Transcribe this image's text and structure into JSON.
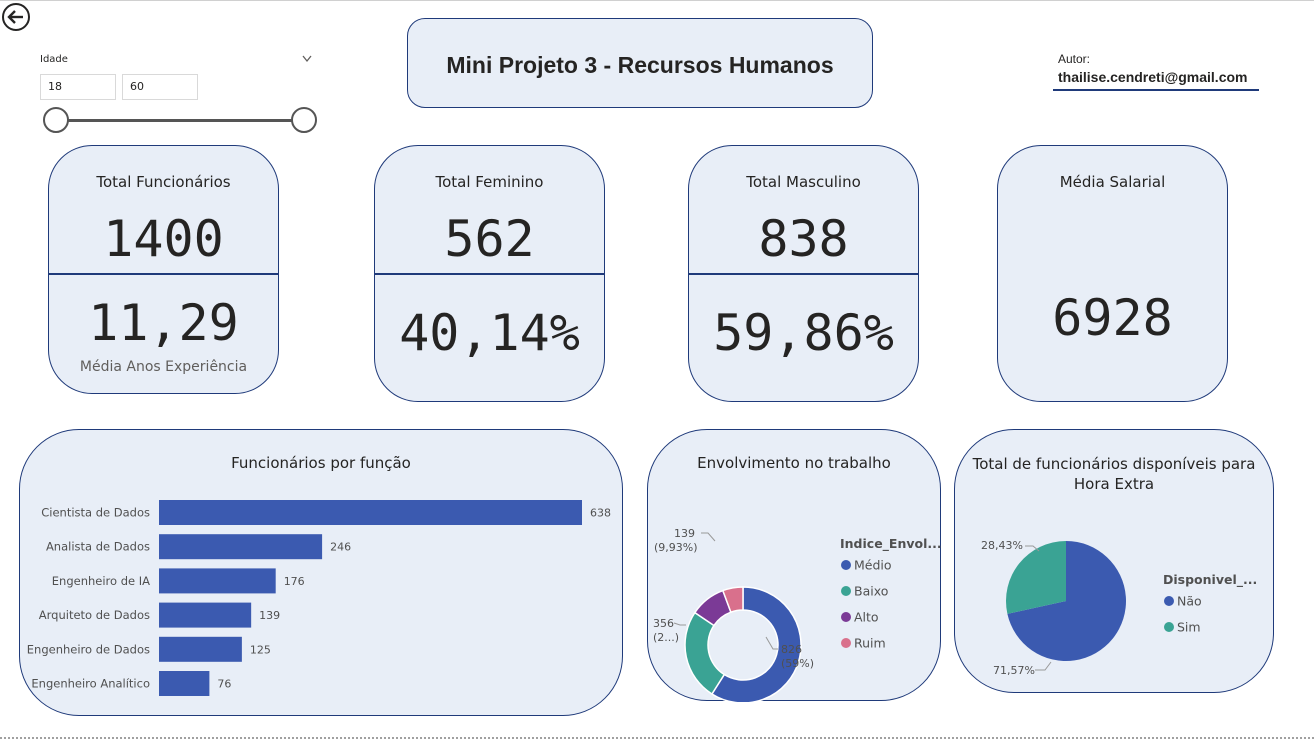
{
  "header": {
    "title": "Mini Projeto 3 - Recursos Humanos",
    "author_label": "Autor:",
    "author_email": "thailise.cendreti@gmail.com"
  },
  "slicer": {
    "label": "Idade",
    "min_value": "18",
    "max_value": "60"
  },
  "kpis": {
    "total_func": {
      "title": "Total Funcionários",
      "value": "1400",
      "sub_value": "11,29",
      "sub_label": "Média Anos Experiência"
    },
    "total_fem": {
      "title": "Total Feminino",
      "value": "562",
      "sub_value": "40,14%"
    },
    "total_masc": {
      "title": "Total Masculino",
      "value": "838",
      "sub_value": "59,86%"
    },
    "media_sal": {
      "title": "Média Salarial",
      "value": "6928"
    }
  },
  "colors": {
    "accent": "#3b5ab0",
    "card_bg": "#e8eef7",
    "border": "#1f3a7a",
    "medio": "#3b5ab0",
    "baixo": "#3aa394",
    "alto": "#7b3a96",
    "ruim": "#d9708c"
  },
  "chart_data": [
    {
      "type": "bar",
      "title": "Funcionários por função",
      "categories": [
        "Cientista de Dados",
        "Analista de Dados",
        "Engenheiro de IA",
        "Arquiteto de Dados",
        "Engenheiro de Dados",
        "Engenheiro Analítico"
      ],
      "values": [
        638,
        246,
        176,
        139,
        125,
        76
      ],
      "xlim": [
        0,
        638
      ],
      "grid": false
    },
    {
      "type": "pie",
      "title": "Envolvimento no trabalho",
      "legend_title": "Indice_Envol...",
      "legend_position": "right",
      "categories": [
        "Médio",
        "Baixo",
        "Alto",
        "Ruim"
      ],
      "values": [
        826,
        356,
        139,
        79
      ],
      "labels": [
        "826 (59%)",
        "356 (2...)",
        "139 (9,93%)",
        ""
      ]
    },
    {
      "type": "pie",
      "title": "Total de funcionários disponíveis para Hora Extra",
      "legend_title": "Disponivel_...",
      "legend_position": "right",
      "categories": [
        "Não",
        "Sim"
      ],
      "values": [
        71.57,
        28.43
      ],
      "labels": [
        "71,57%",
        "28,43%"
      ]
    }
  ]
}
